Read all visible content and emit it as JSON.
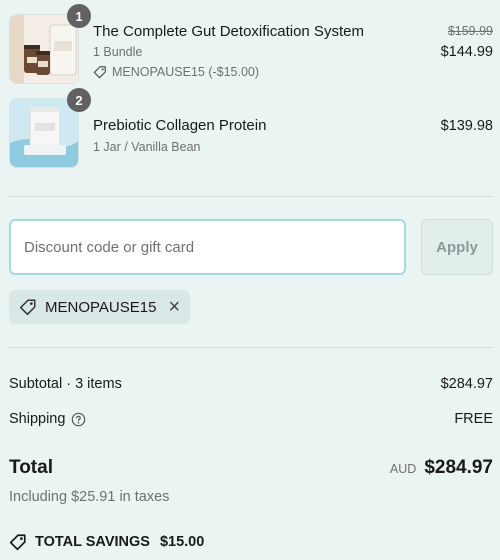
{
  "items": [
    {
      "quantity": "1",
      "title": "The Complete Gut Detoxification System",
      "variant": "1 Bundle",
      "discount": "MENOPAUSE15 (-$15.00)",
      "original_price": "$159.99",
      "price": "$144.99"
    },
    {
      "quantity": "2",
      "title": "Prebiotic Collagen Protein",
      "variant": "1 Jar / Vanilla Bean",
      "price": "$139.98"
    }
  ],
  "discount": {
    "placeholder": "Discount code or gift card",
    "apply_label": "Apply",
    "applied_code": "MENOPAUSE15"
  },
  "summary": {
    "subtotal_label": "Subtotal · 3 items",
    "subtotal_value": "$284.97",
    "shipping_label": "Shipping",
    "shipping_value": "FREE",
    "total_label": "Total",
    "currency": "AUD",
    "total_value": "$284.97",
    "tax_note": "Including $25.91 in taxes",
    "savings_label": "TOTAL SAVINGS",
    "savings_value": "$15.00"
  },
  "icons": {
    "tag": "tag-icon",
    "help": "question-circle-icon",
    "remove": "close-icon"
  },
  "colors": {
    "background": "#eaf4f3",
    "input_focus_border": "#a9d6e2",
    "badge": "#616161",
    "muted_text": "#707070"
  }
}
